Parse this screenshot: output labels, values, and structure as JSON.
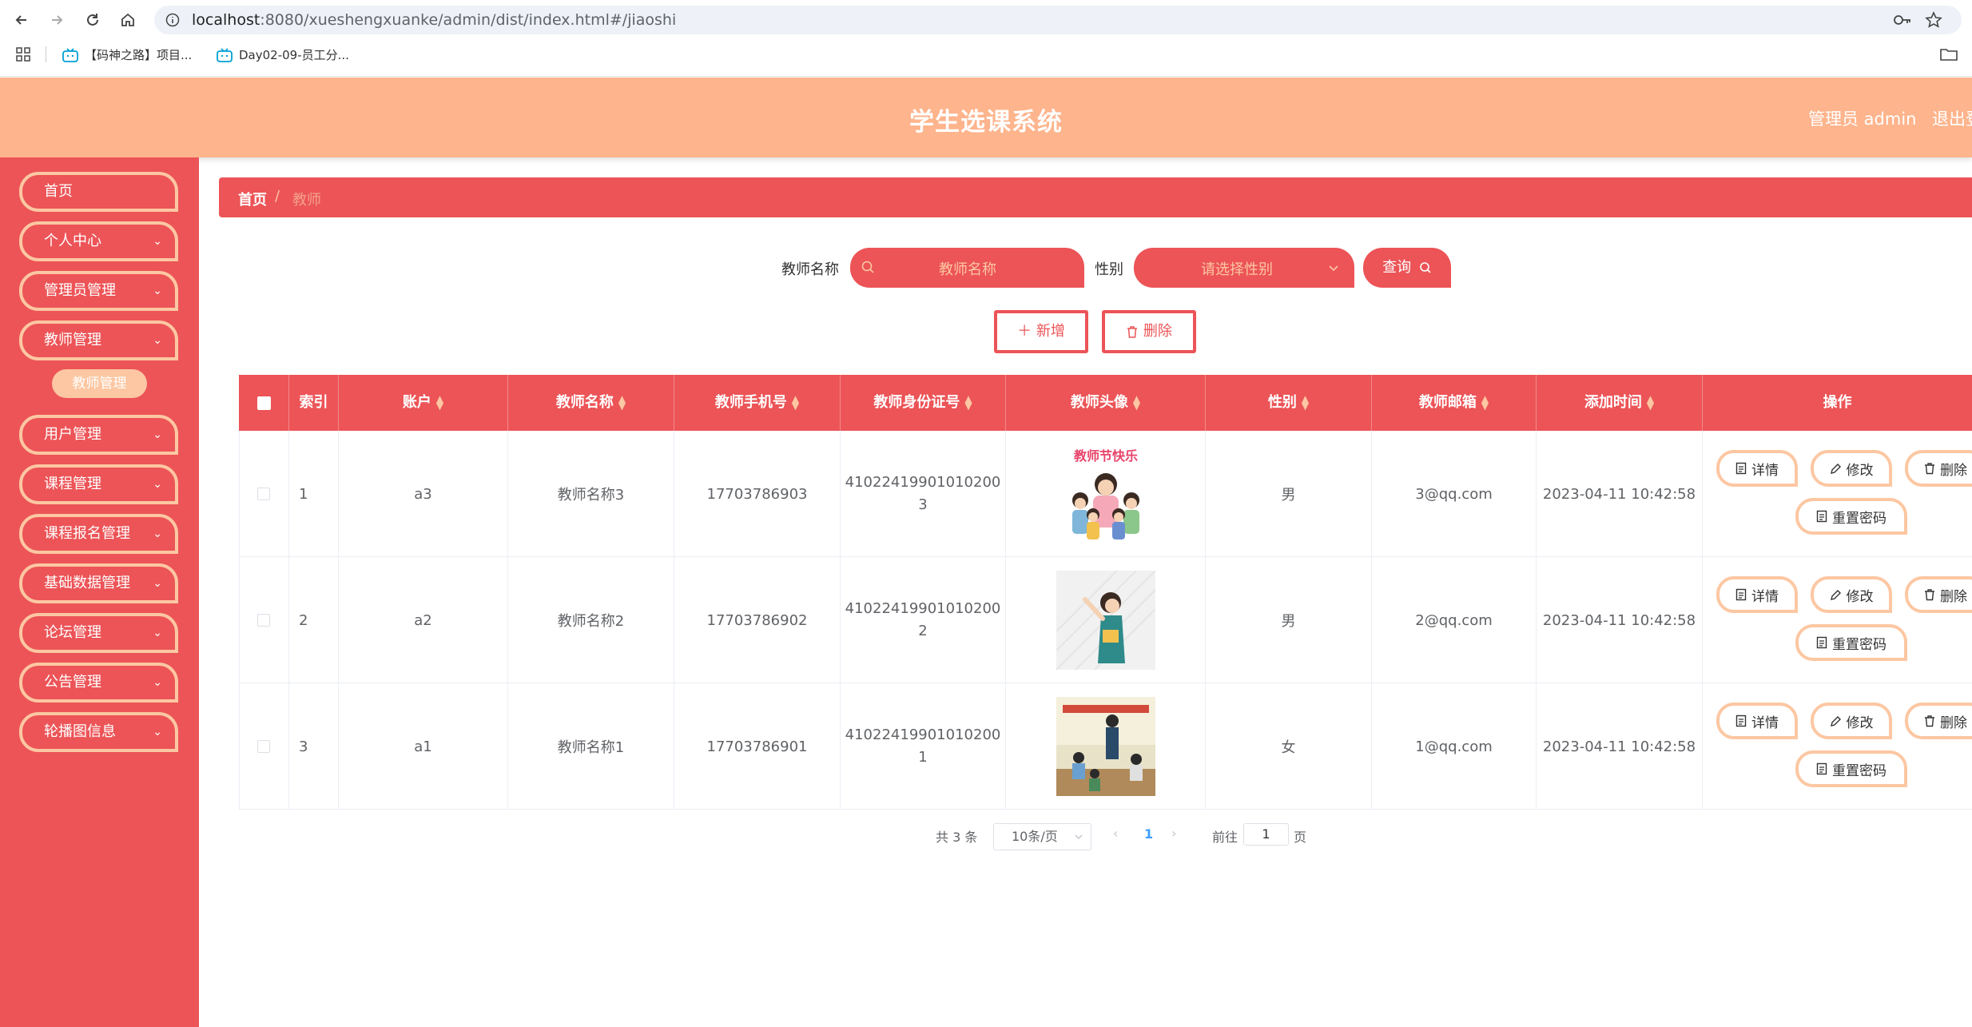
{
  "browser": {
    "url_host": "localhost",
    "url_rest": ":8080/xueshengxuanke/admin/dist/index.html#/jiaoshi",
    "bookmarks": [
      "【码神之路】项目...",
      "Day02-09-员工分..."
    ]
  },
  "header": {
    "title": "学生选课系统",
    "user": "管理员 admin",
    "logout": "退出登"
  },
  "sidebar": {
    "items": [
      {
        "label": "首页",
        "has_arrow": false
      },
      {
        "label": "个人中心",
        "has_arrow": true
      },
      {
        "label": "管理员管理",
        "has_arrow": true
      },
      {
        "label": "教师管理",
        "has_arrow": true
      },
      {
        "label": "用户管理",
        "has_arrow": true
      },
      {
        "label": "课程管理",
        "has_arrow": true
      },
      {
        "label": "课程报名管理",
        "has_arrow": true
      },
      {
        "label": "基础数据管理",
        "has_arrow": true
      },
      {
        "label": "论坛管理",
        "has_arrow": true
      },
      {
        "label": "公告管理",
        "has_arrow": true
      },
      {
        "label": "轮播图信息",
        "has_arrow": true
      }
    ],
    "active_submenu": "教师管理"
  },
  "breadcrumb": {
    "home": "首页",
    "sep": "/",
    "current": "教师"
  },
  "search": {
    "name_label": "教师名称",
    "name_placeholder": "教师名称",
    "gender_label": "性别",
    "gender_placeholder": "请选择性别",
    "query_button": "查询"
  },
  "actions": {
    "add": "新增",
    "delete": "删除"
  },
  "table": {
    "columns": [
      "索引",
      "账户",
      "教师名称",
      "教师手机号",
      "教师身份证号",
      "教师头像",
      "性别",
      "教师邮箱",
      "添加时间",
      "操作"
    ],
    "rows": [
      {
        "index": "1",
        "account": "a3",
        "name": "教师名称3",
        "phone": "17703786903",
        "id_line1": "41022419901010200",
        "id_line2": "3",
        "avatar": "teachers-day-cartoon",
        "gender": "男",
        "email": "3@qq.com",
        "time": "2023-04-11 10:42:58"
      },
      {
        "index": "2",
        "account": "a2",
        "name": "教师名称2",
        "phone": "17703786902",
        "id_line1": "41022419901010200",
        "id_line2": "2",
        "avatar": "teacher-illustration",
        "gender": "男",
        "email": "2@qq.com",
        "time": "2023-04-11 10:42:58"
      },
      {
        "index": "3",
        "account": "a1",
        "name": "教师名称1",
        "phone": "17703786901",
        "id_line1": "41022419901010200",
        "id_line2": "1",
        "avatar": "classroom-photo",
        "gender": "女",
        "email": "1@qq.com",
        "time": "2023-04-11 10:42:58"
      }
    ],
    "row_actions": {
      "detail": "详情",
      "edit": "修改",
      "delete": "删除",
      "reset": "重置密码"
    }
  },
  "avatar_caption": "教师节快乐",
  "pagination": {
    "total": "共 3 条",
    "page_size": "10条/页",
    "current_page": "1",
    "goto_label": "前往",
    "goto_value": "1",
    "page_unit": "页"
  },
  "colors": {
    "primary": "#ec5457",
    "accent": "#fcc7a2",
    "header": "#feb48c"
  }
}
